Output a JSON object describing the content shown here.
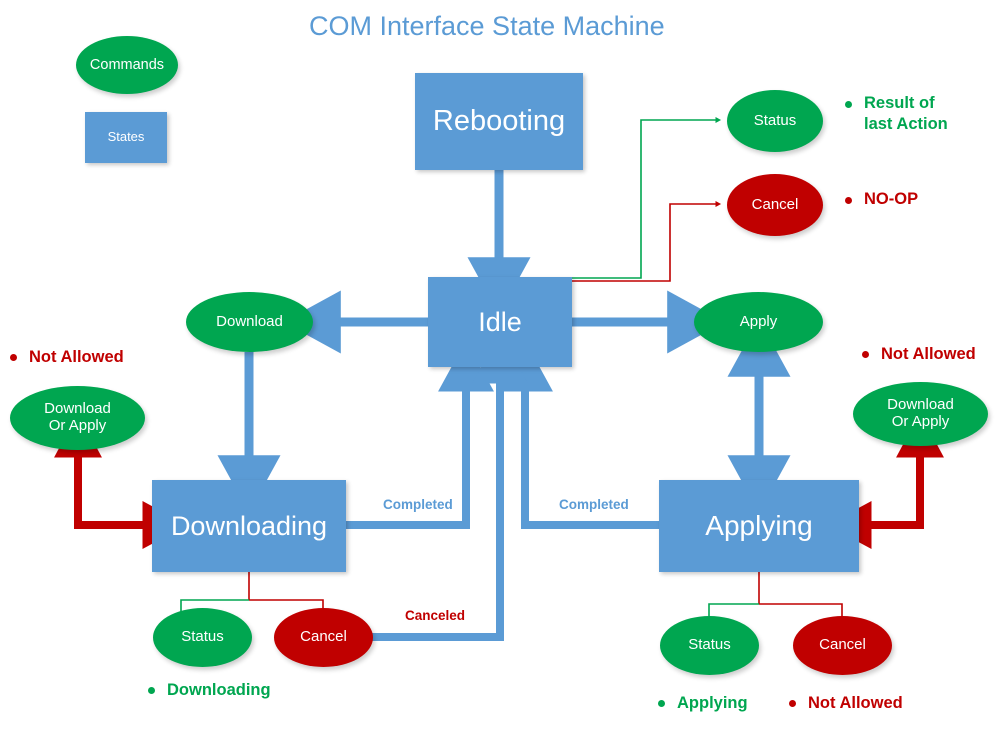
{
  "title": "COM Interface State Machine",
  "legend": {
    "commands_label": "Commands",
    "states_label": "States"
  },
  "states": {
    "rebooting": "Rebooting",
    "idle": "Idle",
    "downloading": "Downloading",
    "applying": "Applying"
  },
  "commands": {
    "download": "Download",
    "apply": "Apply",
    "status_idle": "Status",
    "cancel_idle": "Cancel",
    "status_downloading": "Status",
    "cancel_downloading": "Cancel",
    "status_applying": "Status",
    "cancel_applying": "Cancel",
    "download_or_apply_left": "Download\nOr Apply",
    "download_or_apply_right": "Download\nOr Apply"
  },
  "edge_labels": {
    "completed_download": "Completed",
    "completed_apply": "Completed",
    "canceled": "Canceled"
  },
  "notes": {
    "idle_status": "Result of\nlast Action",
    "idle_cancel": "NO-OP",
    "left_not_allowed": "Not Allowed",
    "right_not_allowed": "Not Allowed",
    "downloading_status": "Downloading",
    "applying_status": "Applying",
    "applying_cancel_not_allowed": "Not Allowed"
  },
  "colors": {
    "state_blue": "#5B9BD5",
    "command_green": "#00A650",
    "cancel_red": "#C00000",
    "title_blue": "#5B9BD5",
    "thin_green": "#00A650",
    "thin_red": "#C00000"
  }
}
